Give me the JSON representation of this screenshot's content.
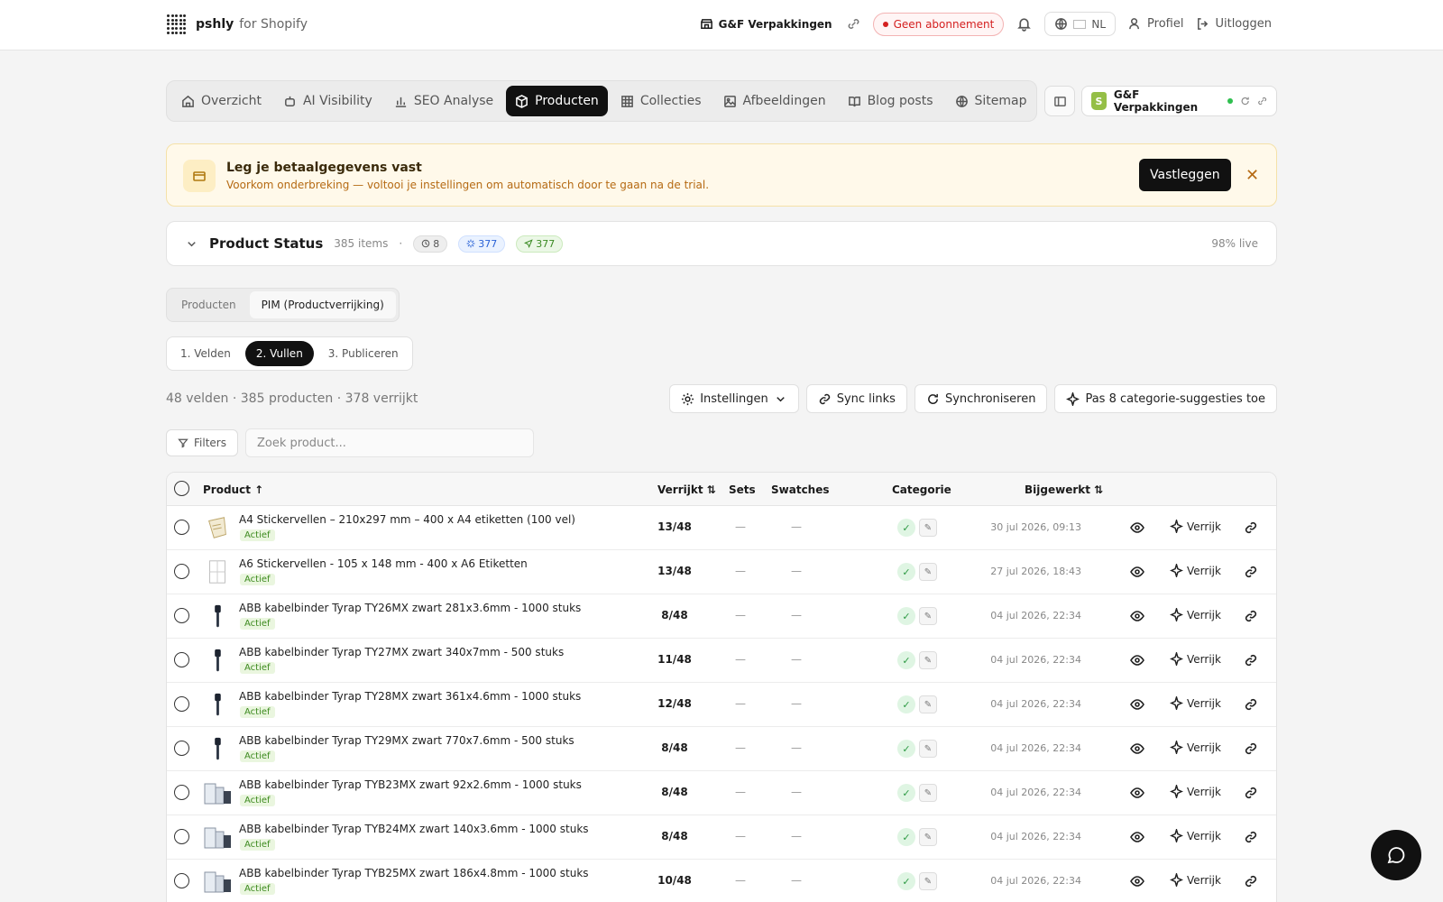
{
  "brand": {
    "name": "pshly",
    "suffix": "for Shopify"
  },
  "topbar": {
    "shop": "G&F Verpakkingen",
    "subscription": "Geen abonnement",
    "language": "NL",
    "profile": "Profiel",
    "logout": "Uitloggen"
  },
  "nav": {
    "tabs": [
      {
        "label": "Overzicht",
        "icon": "home-icon"
      },
      {
        "label": "AI Visibility",
        "icon": "bot-icon"
      },
      {
        "label": "SEO Analyse",
        "icon": "bar-chart-icon"
      },
      {
        "label": "Producten",
        "icon": "package-icon",
        "active": true
      },
      {
        "label": "Collecties",
        "icon": "grid-icon"
      },
      {
        "label": "Afbeeldingen",
        "icon": "image-icon"
      },
      {
        "label": "Blog posts",
        "icon": "book-icon"
      },
      {
        "label": "Sitemap",
        "icon": "globe-icon"
      }
    ],
    "store_chip": "G&F Verpakkingen"
  },
  "banner": {
    "title": "Leg je betaalgegevens vast",
    "subtitle": "Voorkom onderbreking — voltooi je instellingen om automatisch door te gaan na de trial.",
    "button": "Vastleggen"
  },
  "status": {
    "title": "Product Status",
    "items": "385 items",
    "sep": "·",
    "pending": "8",
    "enriched": "377",
    "published": "377",
    "live": "98% live"
  },
  "segments": {
    "products": "Producten",
    "pim": "PIM (Productverrijking)"
  },
  "steps": {
    "s1": "1. Velden",
    "s2": "2. Vullen",
    "s3": "3. Publiceren"
  },
  "summary": "48 velden · 385 producten · 378 verrijkt",
  "actions": {
    "settings": "Instellingen",
    "sync_links": "Sync links",
    "sync": "Synchroniseren",
    "apply": "Pas 8 categorie-suggesties toe"
  },
  "filters": "Filters",
  "search": {
    "placeholder": "Zoek product..."
  },
  "table": {
    "headers": {
      "product": "Product ↑",
      "enriched": "Verrijkt ⇅",
      "sets": "Sets",
      "swatches": "Swatches",
      "category": "Categorie",
      "updated": "Bijgewerkt ⇅"
    },
    "action_label": "Verrijk",
    "rows": [
      {
        "name": "A4 Stickervellen – 210x297 mm – 400 x A4 etiketten (100 vel)",
        "status": "Actief",
        "enriched": "13/48",
        "sets": "—",
        "swatches": "—",
        "updated": "30 jul 2026, 09:13",
        "thumb": "sticker-sheet"
      },
      {
        "name": "A6 Stickervellen - 105 x 148 mm - 400 x A6 Etiketten",
        "status": "Actief",
        "enriched": "13/48",
        "sets": "—",
        "swatches": "—",
        "updated": "27 jul 2026, 18:43",
        "thumb": "label-sheet"
      },
      {
        "name": "ABB kabelbinder Tyrap TY26MX zwart 281x3.6mm - 1000 stuks",
        "status": "Actief",
        "enriched": "8/48",
        "sets": "—",
        "swatches": "—",
        "updated": "04 jul 2026, 22:34",
        "thumb": "cable-tie"
      },
      {
        "name": "ABB kabelbinder Tyrap TY27MX zwart 340x7mm - 500 stuks",
        "status": "Actief",
        "enriched": "11/48",
        "sets": "—",
        "swatches": "—",
        "updated": "04 jul 2026, 22:34",
        "thumb": "cable-tie"
      },
      {
        "name": "ABB kabelbinder Tyrap TY28MX zwart 361x4.6mm - 1000 stuks",
        "status": "Actief",
        "enriched": "12/48",
        "sets": "—",
        "swatches": "—",
        "updated": "04 jul 2026, 22:34",
        "thumb": "cable-tie"
      },
      {
        "name": "ABB kabelbinder Tyrap TY29MX zwart 770x7.6mm - 500 stuks",
        "status": "Actief",
        "enriched": "8/48",
        "sets": "—",
        "swatches": "—",
        "updated": "04 jul 2026, 22:34",
        "thumb": "cable-tie"
      },
      {
        "name": "ABB kabelbinder Tyrap TYB23MX zwart 92x2.6mm - 1000 stuks",
        "status": "Actief",
        "enriched": "8/48",
        "sets": "—",
        "swatches": "—",
        "updated": "04 jul 2026, 22:34",
        "thumb": "bag-pack"
      },
      {
        "name": "ABB kabelbinder Tyrap TYB24MX zwart 140x3.6mm - 1000 stuks",
        "status": "Actief",
        "enriched": "8/48",
        "sets": "—",
        "swatches": "—",
        "updated": "04 jul 2026, 22:34",
        "thumb": "bag-pack"
      },
      {
        "name": "ABB kabelbinder Tyrap TYB25MX zwart 186x4.8mm - 1000 stuks",
        "status": "Actief",
        "enriched": "10/48",
        "sets": "—",
        "swatches": "—",
        "updated": "04 jul 2026, 22:34",
        "thumb": "bag-pack"
      }
    ]
  },
  "colors": {
    "accent": "#111111",
    "danger": "#d42020",
    "success": "#2e9a44",
    "warning_bg": "#fff9ea"
  }
}
